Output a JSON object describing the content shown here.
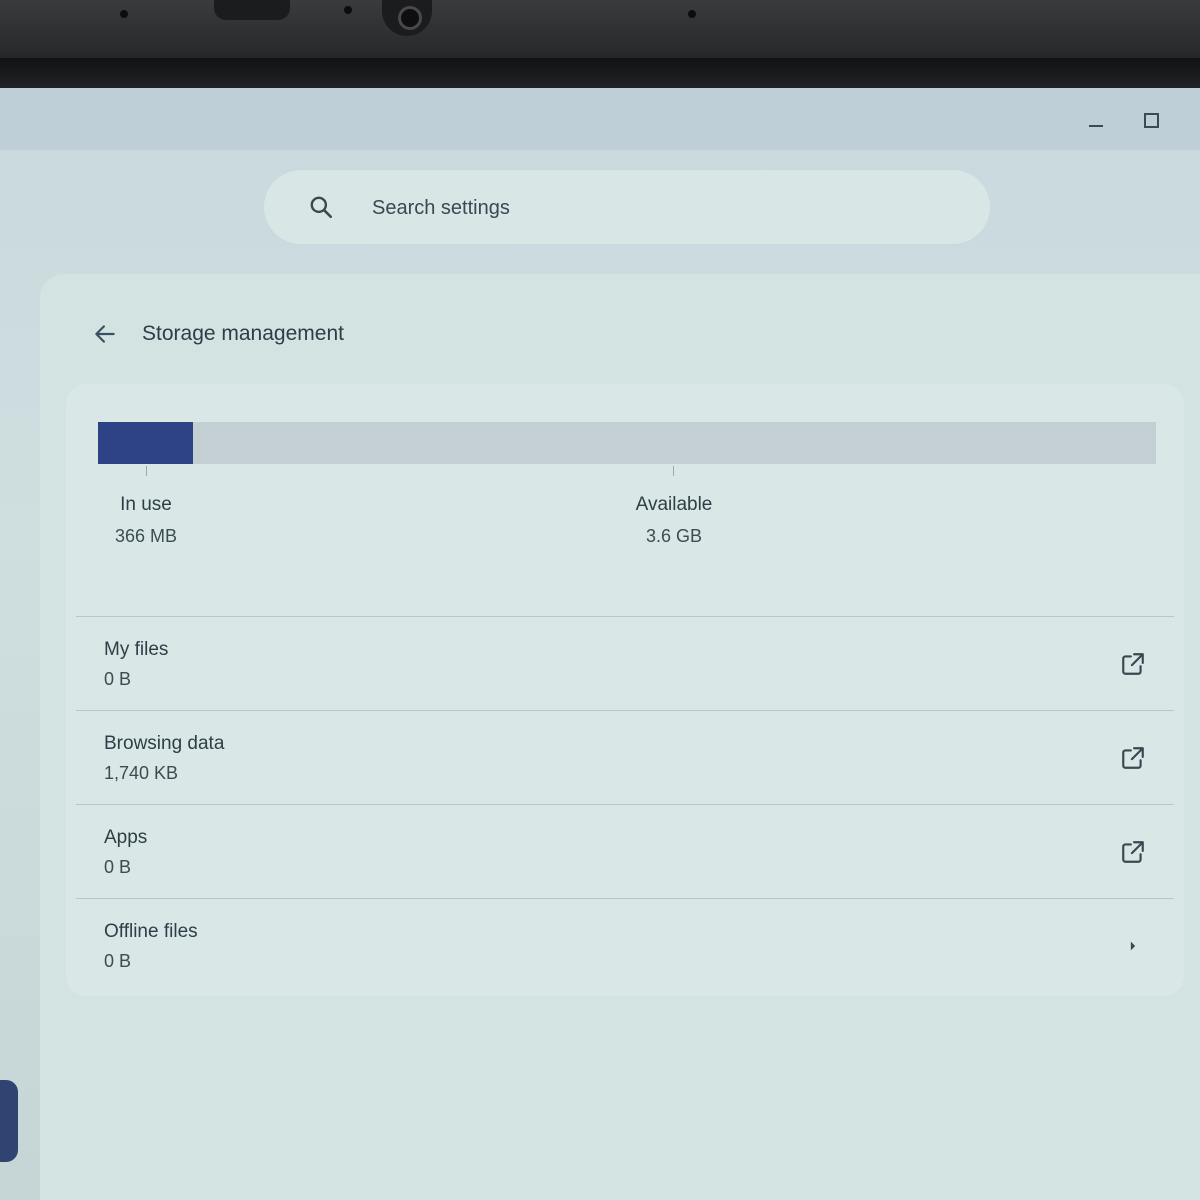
{
  "search": {
    "placeholder": "Search settings"
  },
  "header": {
    "title": "Storage management"
  },
  "storage": {
    "used_fraction": 0.09,
    "in_use": {
      "label": "In use",
      "value": "366 MB"
    },
    "available": {
      "label": "Available",
      "value": "3.6 GB"
    }
  },
  "items": [
    {
      "title": "My files",
      "subtitle": "0 B",
      "icon": "open-in-new-icon"
    },
    {
      "title": "Browsing data",
      "subtitle": "1,740 KB",
      "icon": "open-in-new-icon"
    },
    {
      "title": "Apps",
      "subtitle": "0 B",
      "icon": "open-in-new-icon"
    },
    {
      "title": "Offline files",
      "subtitle": "0 B",
      "icon": "chevron-right-icon"
    }
  ],
  "colors": {
    "accent": "#2e4386",
    "bar_track": "#c3cfd3",
    "text": "#2f3d47"
  }
}
